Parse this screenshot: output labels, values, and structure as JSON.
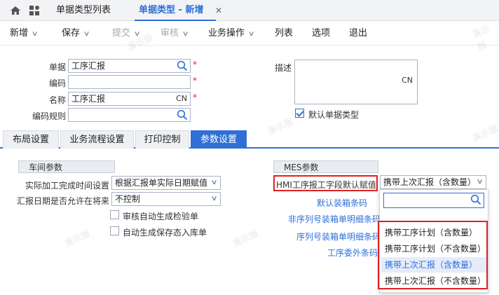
{
  "tabs": {
    "list_tab": "单据类型列表",
    "active_tab": "单据类型 - 新增",
    "close": "✕"
  },
  "toolbar": {
    "new": "新增",
    "save": "保存",
    "submit": "提交",
    "audit": "审核",
    "business": "业务操作",
    "list": "列表",
    "options": "选项",
    "exit": "退出"
  },
  "header": {
    "doc_label": "单据",
    "doc_value": "工序汇报",
    "code_label": "编码",
    "code_value": "",
    "name_label": "名称",
    "name_value": "工序汇报",
    "rule_label": "编码规则",
    "rule_value": "",
    "desc_label": "描述",
    "cn": "CN",
    "required_mark": "*",
    "default_label": "默认单据类型",
    "default_checked": true
  },
  "section_tabs": [
    "布局设置",
    "业务流程设置",
    "打印控制",
    "参数设置"
  ],
  "workshop": {
    "title": "车间参数",
    "finish_time_label": "实际加工完成时间设置",
    "finish_time_value": "根据汇报单实际日期赋值",
    "report_date_label": "汇报日期是否允许在将来",
    "report_date_value": "不控制",
    "auto_inspect_label": "审核自动生成检验单",
    "auto_stock_label": "自动生成保存态入库单"
  },
  "mes": {
    "title": "MES参数",
    "hmi_label": "HMI工序报工字段默认赋值",
    "hmi_value": "携带上次汇报（含数量）",
    "link_default_box": "默认装箱条码",
    "link_nonseq_box": "非序列号装箱单明细条码",
    "link_seq_box": "序列号装箱单明细条码",
    "link_outsource": "工序委外条码"
  },
  "popup": {
    "options": [
      "携带工序计划（含数量）",
      "携带工序计划（不含数量）",
      "携带上次汇报（含数量）",
      "携带上次汇报（不含数量）"
    ],
    "selected_index": 2
  },
  "watermark": "演示版",
  "colors": {
    "accent": "#2f6fd6",
    "highlight": "#e02020"
  }
}
